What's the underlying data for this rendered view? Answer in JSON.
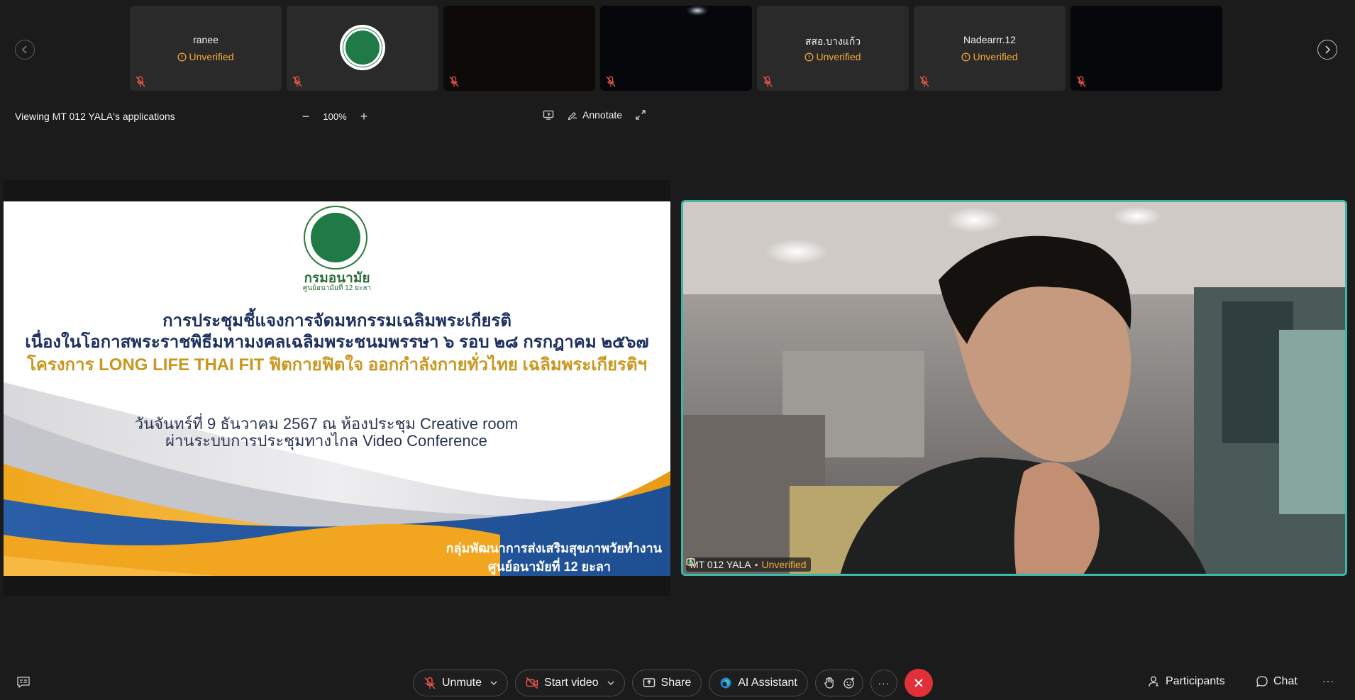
{
  "participants_strip": {
    "tiles": [
      {
        "name": "ranee",
        "status": "Unverified"
      },
      {
        "name": "",
        "status": ""
      },
      {
        "name": "",
        "status": ""
      },
      {
        "name": "",
        "status": ""
      },
      {
        "name": "สสอ.บางแก้ว",
        "status": "Unverified"
      },
      {
        "name": "Nadearrr.12",
        "status": "Unverified"
      },
      {
        "name": "",
        "status": ""
      }
    ],
    "prev_icon": "chevron-left-icon",
    "next_icon": "chevron-right-icon"
  },
  "share_bar": {
    "viewing_text": "Viewing MT 012 YALA's applications",
    "zoom_minus": "−",
    "zoom_value": "100%",
    "zoom_plus": "+",
    "annotate_label": "Annotate"
  },
  "slide": {
    "org_name": "กรมอนามัย",
    "org_sub": "ศูนย์อนามัยที่ 12 ยะลา",
    "title_line1": "การประชุมชี้แจงการจัดมหกรรมเฉลิมพระเกียรติ",
    "title_line2": "เนื่องในโอกาสพระราชพิธีมหามงคลเฉลิมพระชนมพรรษา ๖ รอบ ๒๘ กรกฎาคม ๒๕๖๗",
    "title_line3": "โครงการ LONG LIFE THAI FIT ฟิตกายฟิตใจ ออกกำลังกายทั่วไทย เฉลิมพระเกียรติฯ",
    "date_line1": "วันจันทร์ที่ 9 ธันวาคม 2567 ณ ห้องประชุม Creative room",
    "date_line2": "ผ่านระบบการประชุมทางไกล Video Conference",
    "footer_line1": "กลุ่มพัฒนาการส่งเสริมสุขภาพวัยทำงาน",
    "footer_line2": "ศูนย์อนามัยที่ 12 ยะลา"
  },
  "video": {
    "name": "MT 012 YALA",
    "separator": "•",
    "status": "Unverified",
    "accent": "#3fb7a7"
  },
  "controls": {
    "unmute_label": "Unmute",
    "start_video_label": "Start video",
    "share_label": "Share",
    "ai_assistant_label": "AI Assistant",
    "more_label": "···",
    "participants_label": "Participants",
    "chat_label": "Chat",
    "overflow_label": "···",
    "end_color": "#e0303a",
    "warning_color": "#f2a93b"
  }
}
